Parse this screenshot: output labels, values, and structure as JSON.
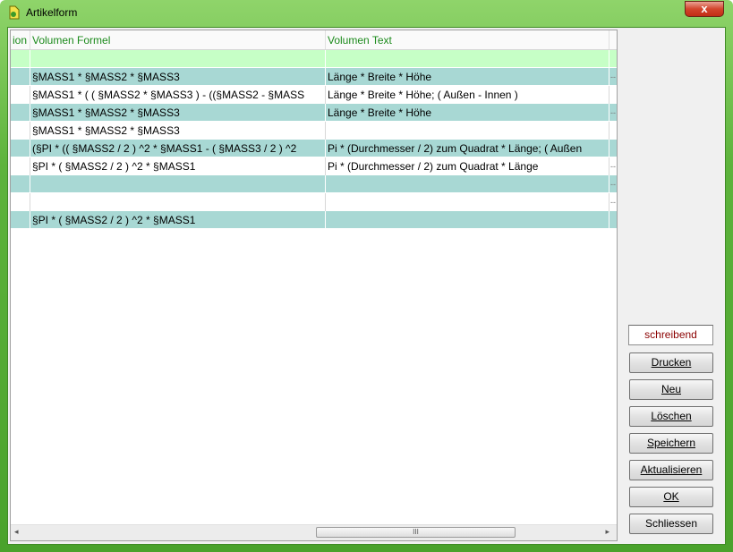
{
  "window": {
    "title": "Artikelform",
    "close_label": "x"
  },
  "colors": {
    "row_tinted": "#a8d8d4",
    "row_plain": "#ffffff",
    "new_row": "#c6ffc6",
    "header_text": "#1b8a1b",
    "status_text": "#8b0000"
  },
  "grid": {
    "columns": [
      "ion",
      "Volumen Formel",
      "Volumen Text"
    ],
    "rows": [
      {
        "formula": "",
        "text": "",
        "extra": ""
      },
      {
        "formula": "§MASS1  * §MASS2  * §MASS3",
        "text": "Länge * Breite * Höhe",
        "extra": "--"
      },
      {
        "formula": "§MASS1  * ( ( §MASS2  * §MASS3 ) - ((§MASS2 - §MASS",
        "text": "Länge * Breite * Höhe; ( Außen - Innen )",
        "extra": ""
      },
      {
        "formula": "§MASS1  * §MASS2  * §MASS3",
        "text": "Länge * Breite * Höhe",
        "extra": "--"
      },
      {
        "formula": "§MASS1  * §MASS2  * §MASS3",
        "text": "",
        "extra": ""
      },
      {
        "formula": "(§PI * (( §MASS2 / 2 ) ^2 * §MASS1 - ( §MASS3 / 2 ) ^2",
        "text": "Pi * (Durchmesser / 2) zum Quadrat * Länge; ( Außen",
        "extra": ""
      },
      {
        "formula": "§PI * ( §MASS2 / 2 ) ^2 * §MASS1",
        "text": "Pi * (Durchmesser / 2) zum Quadrat * Länge",
        "extra": "--"
      },
      {
        "formula": "",
        "text": "",
        "extra": "--"
      },
      {
        "formula": "",
        "text": "",
        "extra": "--"
      },
      {
        "formula": "§PI * ( §MASS2 / 2 ) ^2 * §MASS1",
        "text": "",
        "extra": ""
      }
    ]
  },
  "scrollbar": {
    "left_arrow": "◂",
    "right_arrow": "▸",
    "grip": "III"
  },
  "status_label": "schreibend",
  "buttons": [
    {
      "id": "drucken",
      "label": "Drucken"
    },
    {
      "id": "neu",
      "label": "Neu"
    },
    {
      "id": "loeschen",
      "label": "Löschen"
    },
    {
      "id": "speichern",
      "label": "Speichern"
    },
    {
      "id": "aktualisieren",
      "label": "Aktualisieren"
    },
    {
      "id": "ok",
      "label": "OK"
    },
    {
      "id": "schliessen",
      "label": "Schliessen"
    }
  ]
}
